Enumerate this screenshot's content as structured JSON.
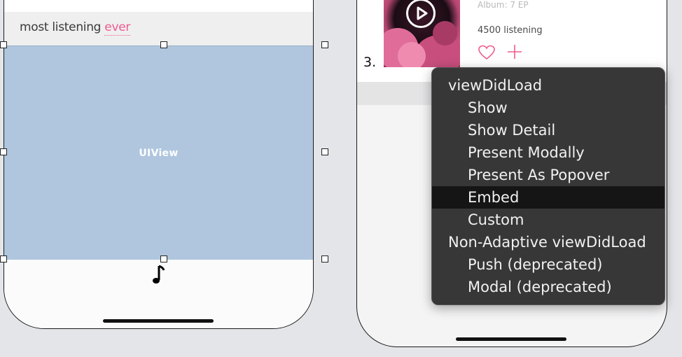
{
  "left_phone": {
    "heading_text": "most listening",
    "heading_accent": "ever",
    "uiview_label": "UIView"
  },
  "right_phone": {
    "album_line": "Album: 7 EP",
    "listening_count": "4500 listening",
    "rank_label": "3."
  },
  "icons": [
    "music-note-icon",
    "play-icon",
    "heart-icon",
    "plus-icon"
  ],
  "colors": {
    "accent_pink": "#ef5b8d",
    "uiview_blue": "#afc6de",
    "menu_bg": "#373737",
    "menu_highlight": "#151515"
  },
  "segue_menu": {
    "items": [
      {
        "label": "viewDidLoad",
        "kind": "section"
      },
      {
        "label": "Show",
        "kind": "option"
      },
      {
        "label": "Show Detail",
        "kind": "option"
      },
      {
        "label": "Present Modally",
        "kind": "option"
      },
      {
        "label": "Present As Popover",
        "kind": "option"
      },
      {
        "label": "Embed",
        "kind": "option",
        "highlighted": true
      },
      {
        "label": "Custom",
        "kind": "option"
      },
      {
        "label": "Non-Adaptive viewDidLoad",
        "kind": "section"
      },
      {
        "label": "Push (deprecated)",
        "kind": "option"
      },
      {
        "label": "Modal (deprecated)",
        "kind": "option"
      }
    ]
  }
}
